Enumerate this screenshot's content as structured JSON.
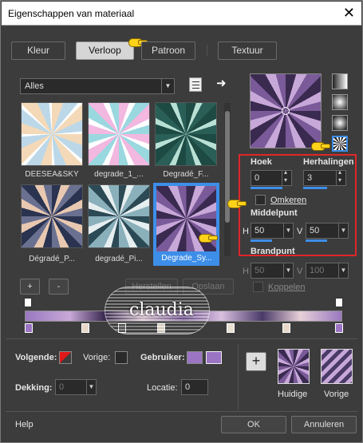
{
  "window": {
    "title": "Eigenschappen van materiaal",
    "close_glyph": "✕"
  },
  "tabs": [
    {
      "label": "Kleur"
    },
    {
      "label": "Verloop"
    },
    {
      "label": "Patroon"
    },
    {
      "label": "Textuur"
    }
  ],
  "category": {
    "value": "Alles"
  },
  "gradients": [
    {
      "label": "DEESEA&SKY"
    },
    {
      "label": "degrade_1_..."
    },
    {
      "label": "Degradé_F..."
    },
    {
      "label": "Dégradé_P..."
    },
    {
      "label": "degradé_Pi..."
    },
    {
      "label": "Degrade_Sy..."
    }
  ],
  "buttons": {
    "add": "+",
    "remove": "-",
    "restore": "Herstellen",
    "save": "Opslaan",
    "ok": "OK",
    "cancel": "Annuleren",
    "help": "Help",
    "plus": "+"
  },
  "controls": {
    "angle_label": "Hoek",
    "angle_value": "0",
    "repeats_label": "Herhalingen",
    "repeats_value": "3",
    "invert_label": "Omkeren",
    "center_label": "Middelpunt",
    "center_h_label": "H",
    "center_h_value": "50",
    "center_v_label": "V",
    "center_v_value": "50",
    "focal_label": "Brandpunt",
    "focal_h_label": "H",
    "focal_h_value": "50",
    "focal_v_label": "V",
    "focal_v_value": "100",
    "link_label": "Koppelen"
  },
  "bottom": {
    "next_label": "Volgende:",
    "prev_label": "Vorige:",
    "user_label": "Gebruiker:",
    "opacity_label": "Dekking:",
    "opacity_value": "0",
    "location_label": "Locatie:",
    "location_value": "0",
    "current_label": "Huidige",
    "previous_label": "Vorige"
  },
  "watermark": "claudia",
  "colors": {
    "accent": "#3d8ee8",
    "highlight_box": "#e0262a",
    "user_color": "#9b74c4",
    "next_color": "#e01818"
  }
}
